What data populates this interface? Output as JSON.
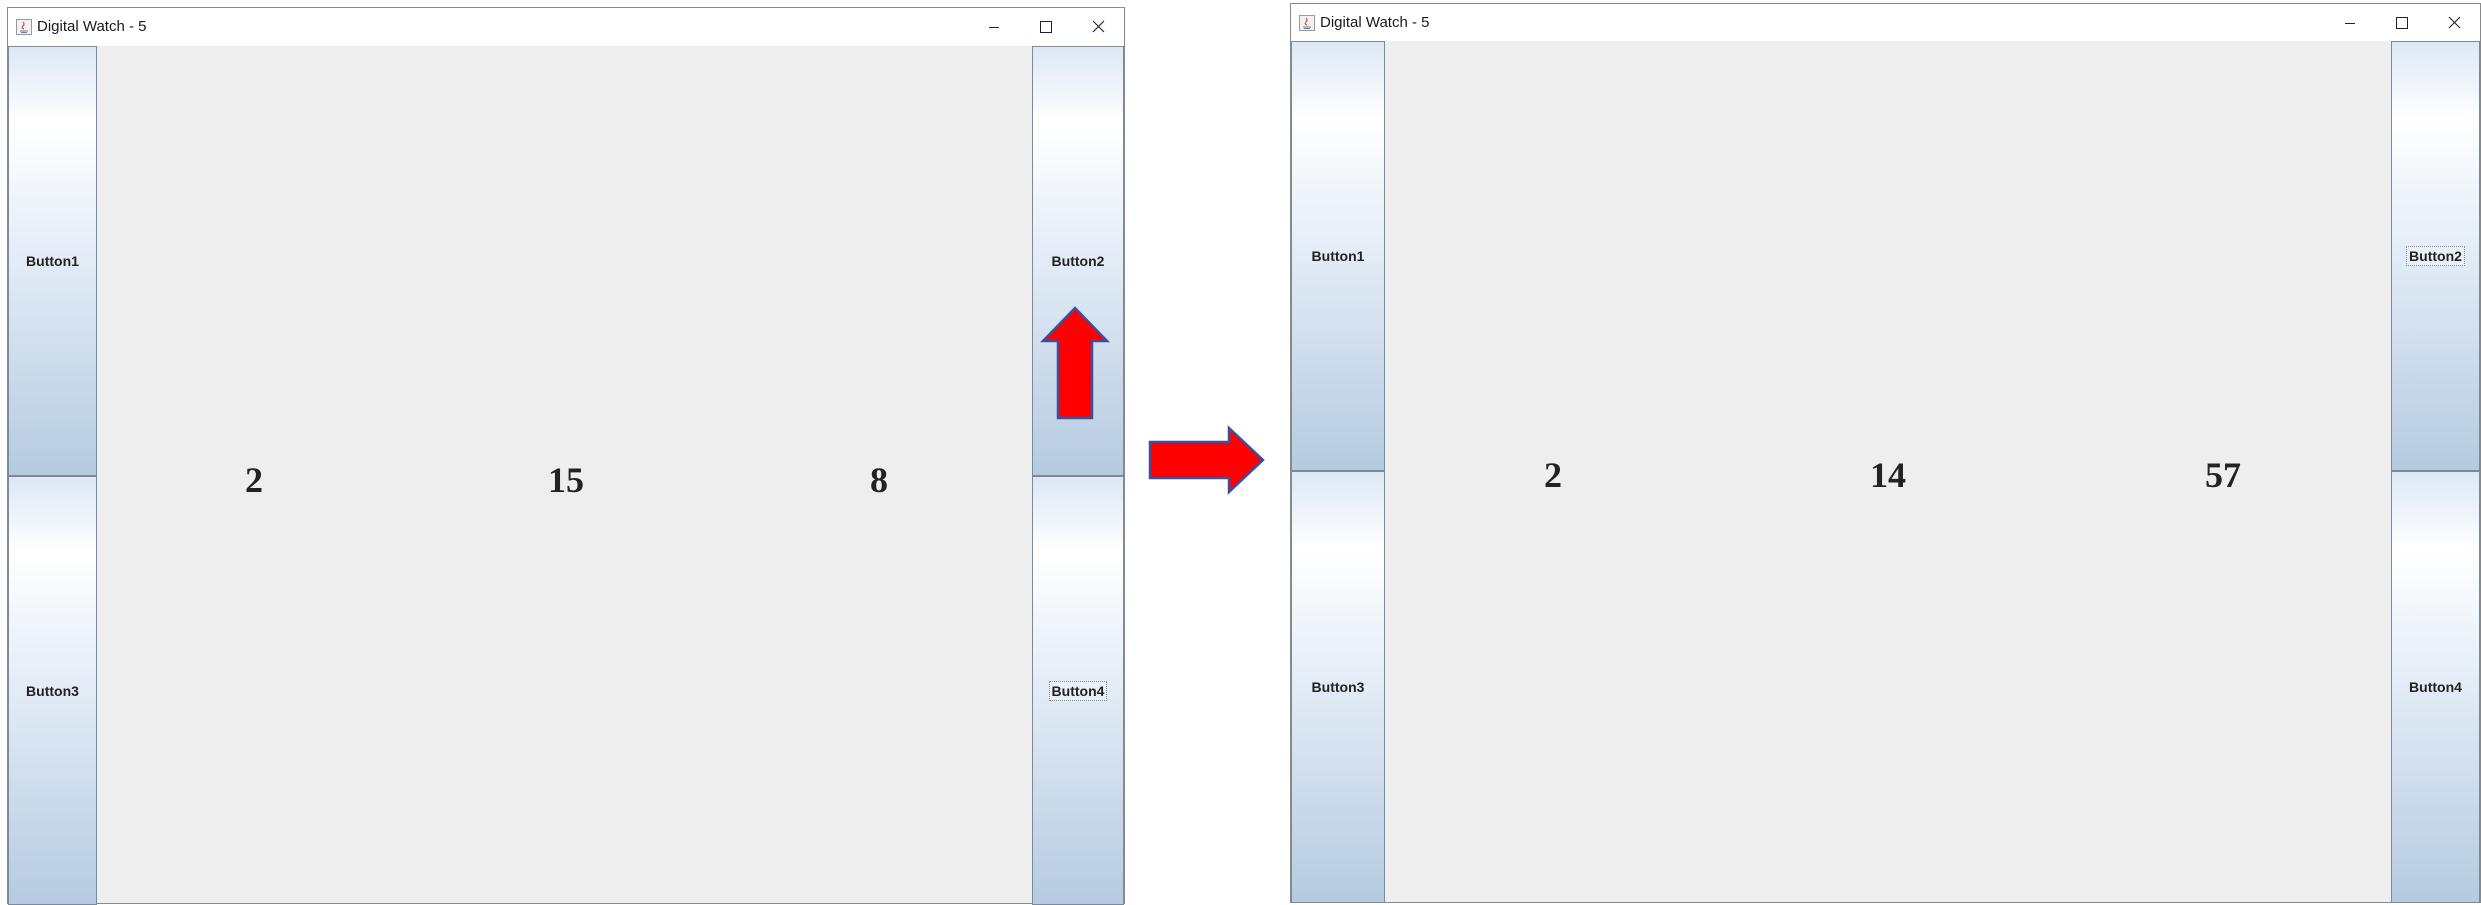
{
  "before": {
    "title": "Digital Watch - 5",
    "buttons": {
      "b1": "Button1",
      "b2": "Button2",
      "b3": "Button3",
      "b4": "Button4"
    },
    "display": {
      "hours": "2",
      "minutes": "15",
      "seconds": "8"
    },
    "focused_button": "Button4"
  },
  "after": {
    "title": "Digital Watch - 5",
    "buttons": {
      "b1": "Button1",
      "b2": "Button2",
      "b3": "Button3",
      "b4": "Button4"
    },
    "display": {
      "hours": "2",
      "minutes": "14",
      "seconds": "57"
    },
    "focused_button": "Button2"
  },
  "annotations": {
    "up_arrow_color": "#ff0000",
    "right_arrow_color": "#ff0000",
    "arrow_outline_color": "#3a4fa0",
    "icons": [
      "java-app-icon",
      "minimize-icon",
      "maximize-icon",
      "close-icon",
      "up-arrow-annotation",
      "right-arrow-annotation"
    ]
  }
}
